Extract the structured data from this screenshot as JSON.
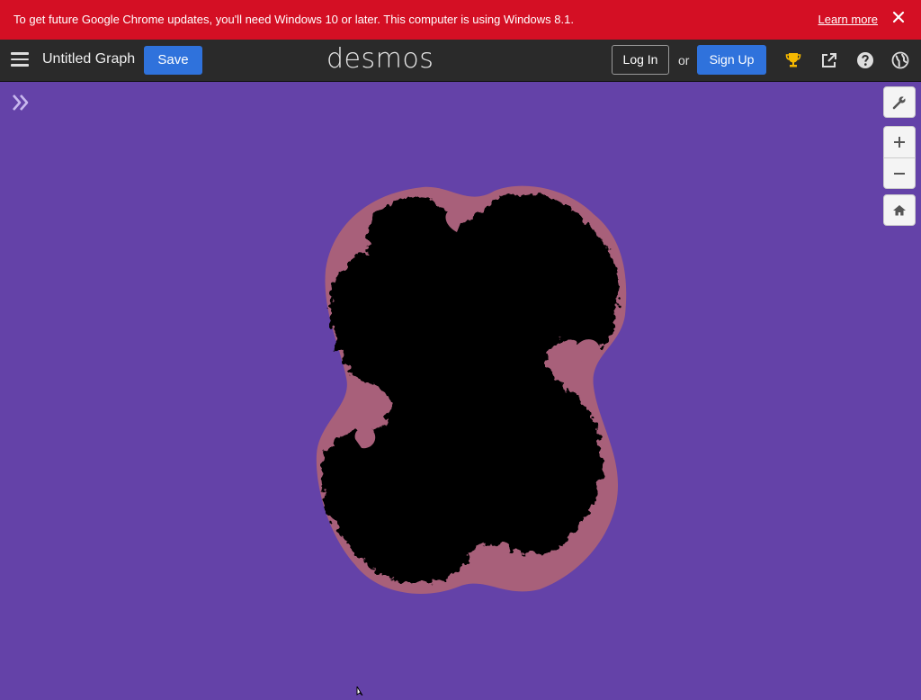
{
  "banner": {
    "message": "To get future Google Chrome updates, you'll need Windows 10 or later. This computer is using Windows 8.1.",
    "learn_more": "Learn more",
    "close_icon": "close-icon",
    "color": "#d40f24"
  },
  "header": {
    "menu_icon": "hamburger-menu-icon",
    "graph_title": "Untitled Graph",
    "save_label": "Save",
    "logo": "desmos",
    "login_label": "Log In",
    "or_text": "or",
    "signup_label": "Sign Up",
    "icons": [
      "trophy-icon",
      "share-icon",
      "help-icon",
      "language-globe-icon"
    ],
    "accent_color": "#2f72dc"
  },
  "graph": {
    "background_color": "#6442a8",
    "fractal_fill": "#000000",
    "fractal_halo": "#a8607a",
    "expand_icon": "expand-expressions-icon",
    "tools": [
      "wrench-settings-icon",
      "zoom-in-icon",
      "zoom-out-icon",
      "home-default-zoom-icon"
    ]
  }
}
